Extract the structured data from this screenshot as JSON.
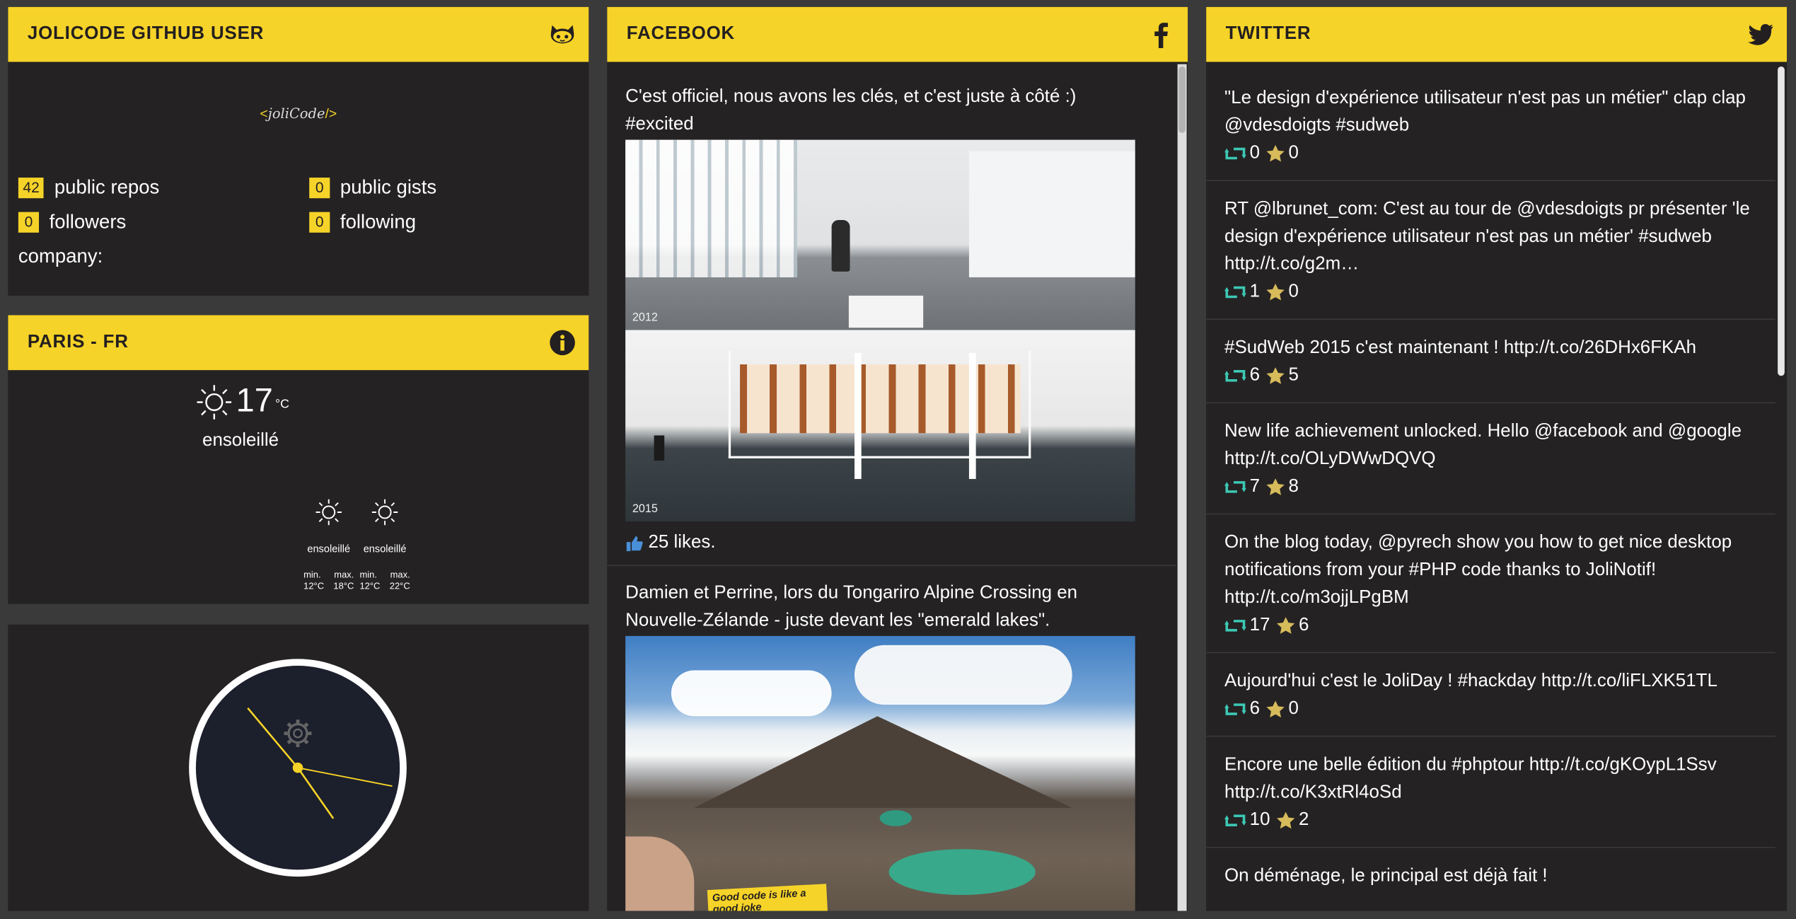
{
  "github": {
    "title": "JOLICODE GITHUB USER",
    "logo_text": "joliCode",
    "stats": [
      {
        "count": "42",
        "label": "public repos"
      },
      {
        "count": "0",
        "label": "public gists"
      },
      {
        "count": "0",
        "label": "followers"
      },
      {
        "count": "0",
        "label": "following"
      }
    ],
    "company_label": "company:"
  },
  "weather": {
    "title": "PARIS - FR",
    "temperature": "17",
    "unit": "°C",
    "condition": "ensoleillé",
    "forecast": [
      {
        "condition": "ensoleillé",
        "min_label": "min.",
        "max_label": "max.",
        "min": "12°C",
        "max": "18°C"
      },
      {
        "condition": "ensoleillé",
        "min_label": "min.",
        "max_label": "max.",
        "min": "12°C",
        "max": "22°C"
      }
    ]
  },
  "clock": {
    "hour_hand_deg": -40,
    "minute_hand_deg": 145,
    "second_hand_deg": 101
  },
  "facebook": {
    "title": "FACEBOOK",
    "posts": [
      {
        "text": "C'est officiel, nous avons les clés, et c'est juste à côté :) #excited",
        "photo_labels": [
          "2012",
          "2015"
        ],
        "likes": "25 likes."
      },
      {
        "text": "Damien et Perrine, lors du Tongariro Alpine Crossing en Nouvelle-Zélande - juste devant les \"emerald lakes\".",
        "sign_text": "Good code is like a good joke"
      }
    ]
  },
  "twitter": {
    "title": "TWITTER",
    "tweets": [
      {
        "text": "\"Le design d'expérience utilisateur n'est pas un métier\" clap clap @vdesdoigts #sudweb",
        "retweets": "0",
        "favorites": "0"
      },
      {
        "text": "RT @lbrunet_com: C'est au tour de @vdesdoigts pr présenter 'le design d'expérience utilisateur n'est pas un métier' #sudweb http://t.co/g2m…",
        "retweets": "1",
        "favorites": "0"
      },
      {
        "text": "#SudWeb 2015 c'est maintenant ! http://t.co/26DHx6FKAh",
        "retweets": "6",
        "favorites": "5"
      },
      {
        "text": "New life achievement unlocked. Hello @facebook and @google http://t.co/OLyDWwDQVQ",
        "retweets": "7",
        "favorites": "8"
      },
      {
        "text": "On the blog today, @pyrech show you how to get nice desktop notifications from your #PHP code thanks to JoliNotif! http://t.co/m3ojjLPgBM",
        "retweets": "17",
        "favorites": "6"
      },
      {
        "text": "Aujourd'hui c'est le JoliDay ! #hackday http://t.co/liFLXK51TL",
        "retweets": "6",
        "favorites": "0"
      },
      {
        "text": "Encore une belle édition du #phptour http://t.co/gKOypL1Ssv http://t.co/K3xtRl4oSd",
        "retweets": "10",
        "favorites": "2"
      },
      {
        "text": "On déménage, le principal est déjà fait !",
        "retweets": "",
        "favorites": ""
      }
    ]
  },
  "colors": {
    "accent": "#f6d328",
    "panel": "#242223",
    "background": "#3a3a3b",
    "retweet": "#3cc8b4",
    "star": "#d7bb5b",
    "like": "#4a90d9"
  }
}
